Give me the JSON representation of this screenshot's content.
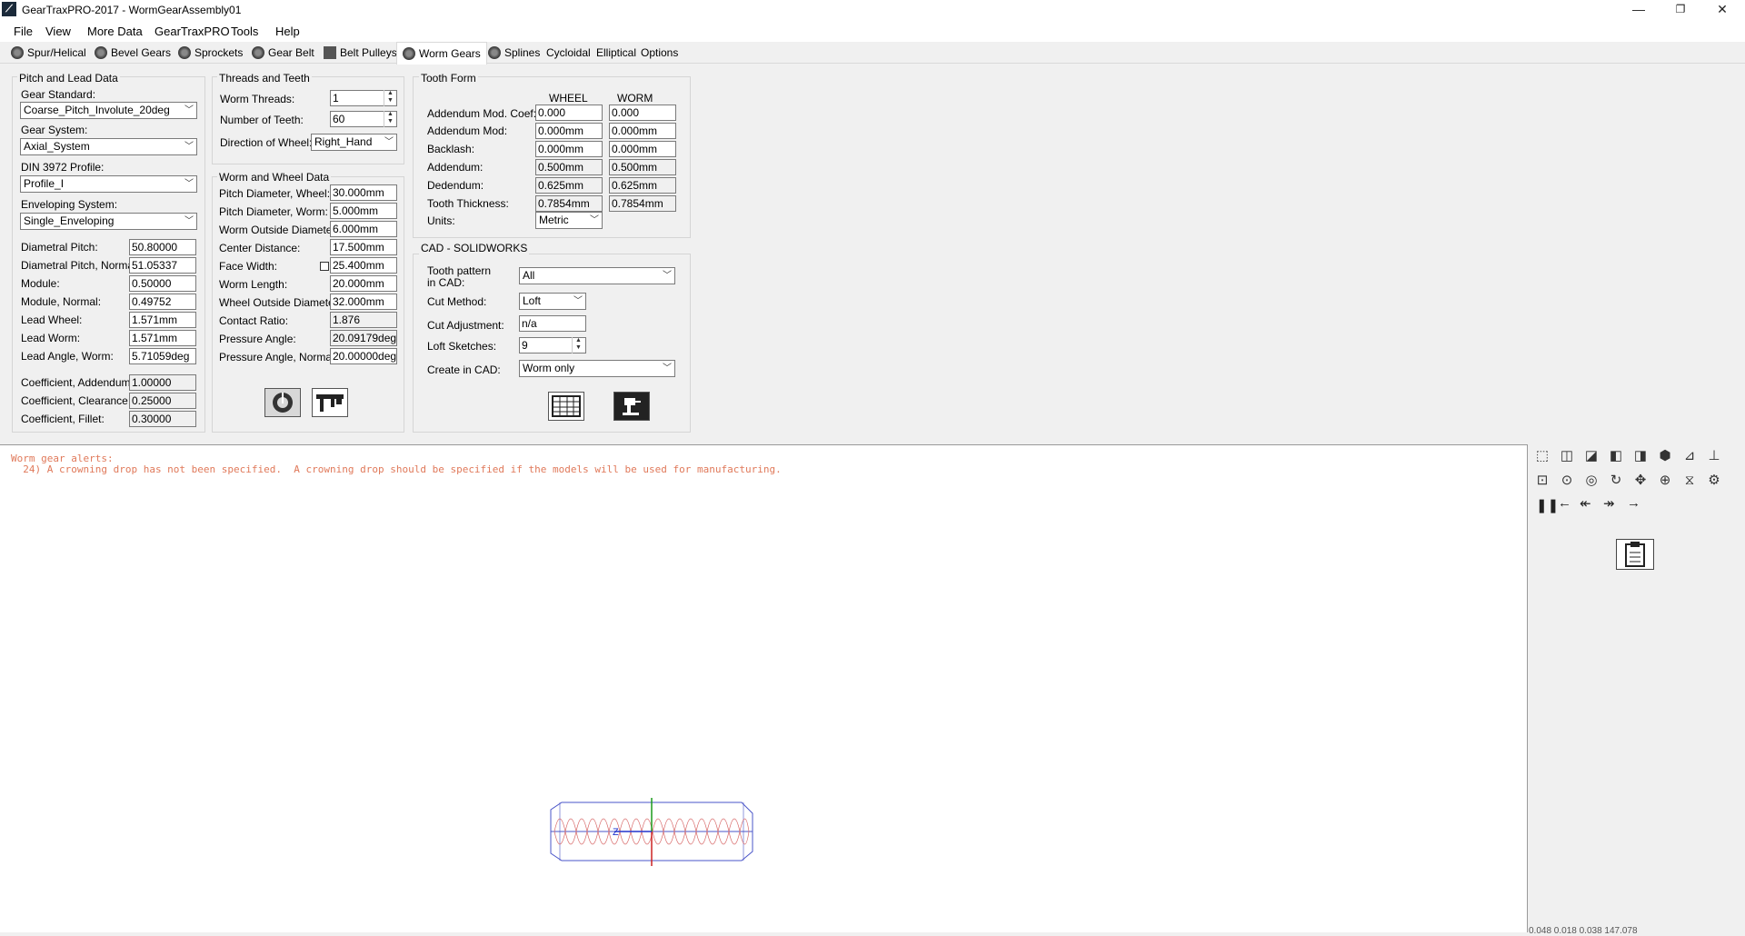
{
  "window": {
    "title": "GearTraxPRO-2017 - WormGearAssembly01",
    "minimize": "—",
    "restore": "❐",
    "close": "✕"
  },
  "menu": [
    "File",
    "View",
    "More Data",
    "GearTraxPRO",
    "Tools",
    "Help"
  ],
  "tabs": [
    "Spur/Helical",
    "Bevel Gears",
    "Sprockets",
    "Gear Belt",
    "Belt Pulleys",
    "Worm Gears",
    "Splines",
    "Cycloidal",
    "Elliptical",
    "Options"
  ],
  "active_tab": "Worm Gears",
  "pitch_lead": {
    "title": "Pitch and Lead Data",
    "gear_standard_label": "Gear Standard:",
    "gear_standard": "Coarse_Pitch_Involute_20deg",
    "gear_system_label": "Gear System:",
    "gear_system": "Axial_System",
    "din_label": "DIN 3972 Profile:",
    "din": "Profile_I",
    "enveloping_label": "Enveloping System:",
    "enveloping": "Single_Enveloping",
    "rows": [
      {
        "label": "Diametral Pitch:",
        "value": "50.80000"
      },
      {
        "label": "Diametral Pitch, Normal:",
        "value": "51.05337"
      },
      {
        "label": "Module:",
        "value": "0.50000"
      },
      {
        "label": "Module, Normal:",
        "value": "0.49752"
      },
      {
        "label": "Lead Wheel:",
        "value": "1.571mm"
      },
      {
        "label": "Lead Worm:",
        "value": "1.571mm"
      },
      {
        "label": "Lead Angle, Worm:",
        "value": "5.71059deg"
      }
    ],
    "coef": [
      {
        "label": "Coefficient, Addendum:",
        "value": "1.00000"
      },
      {
        "label": "Coefficient, Clearance:",
        "value": "0.25000"
      },
      {
        "label": "Coefficient, Fillet:",
        "value": "0.30000"
      }
    ]
  },
  "threads": {
    "title": "Threads and Teeth",
    "worm_threads_label": "Worm Threads:",
    "worm_threads": "1",
    "teeth_label": "Number of Teeth:",
    "teeth": "60",
    "direction_label": "Direction of Wheel:",
    "direction": "Right_Hand"
  },
  "worm_wheel": {
    "title": "Worm and Wheel Data",
    "rows": [
      {
        "label": "Pitch Diameter, Wheel:",
        "value": "30.000mm"
      },
      {
        "label": "Pitch Diameter, Worm:",
        "value": "5.000mm"
      },
      {
        "label": "Worm Outside Diameter:",
        "value": "6.000mm"
      },
      {
        "label": "Center Distance:",
        "value": "17.500mm"
      },
      {
        "label": "Face Width:",
        "value": "25.400mm"
      },
      {
        "label": "Worm Length:",
        "value": "20.000mm"
      },
      {
        "label": "Wheel Outside Diameter:",
        "value": "32.000mm"
      },
      {
        "label": "Contact Ratio:",
        "value": "1.876"
      },
      {
        "label": "Pressure Angle:",
        "value": "20.09179deg"
      },
      {
        "label": "Pressure Angle, Normal:",
        "value": "20.00000deg"
      }
    ]
  },
  "tooth_form": {
    "title": "Tooth Form",
    "col_wheel": "WHEEL",
    "col_worm": "WORM",
    "rows": [
      {
        "label": "Addendum Mod. Coef:",
        "wheel": "0.000",
        "worm": "0.000"
      },
      {
        "label": "Addendum Mod:",
        "wheel": "0.000mm",
        "worm": "0.000mm"
      },
      {
        "label": "Backlash:",
        "wheel": "0.000mm",
        "worm": "0.000mm"
      },
      {
        "label": "Addendum:",
        "wheel": "0.500mm",
        "worm": "0.500mm"
      },
      {
        "label": "Dedendum:",
        "wheel": "0.625mm",
        "worm": "0.625mm"
      },
      {
        "label": "Tooth Thickness:",
        "wheel": "0.7854mm",
        "worm": "0.7854mm"
      }
    ],
    "units_label": "Units:",
    "units": "Metric"
  },
  "cad": {
    "title": "CAD - SOLIDWORKS",
    "tooth_pattern_label_1": "Tooth pattern",
    "tooth_pattern_label_2": "in CAD:",
    "tooth_pattern": "All",
    "cut_method_label": "Cut Method:",
    "cut_method": "Loft",
    "cut_adjust_label": "Cut Adjustment:",
    "cut_adjust": "n/a",
    "loft_label": "Loft Sketches:",
    "loft": "9",
    "create_label": "Create in CAD:",
    "create": "Worm only"
  },
  "alerts": {
    "title": "Worm gear alerts:",
    "line1": "  24) A crowning drop has not been specified.  A crowning drop should be specified if the models will be used for manufacturing."
  },
  "viewport": {
    "axis_label": "Z"
  },
  "status_readout": "0.048  0.018  0.038  147.078",
  "colors": {
    "alert": "#e0795a",
    "model_blue": "#4a55c8",
    "model_red": "#d86a6a",
    "axis_green": "#1a9a1a"
  }
}
